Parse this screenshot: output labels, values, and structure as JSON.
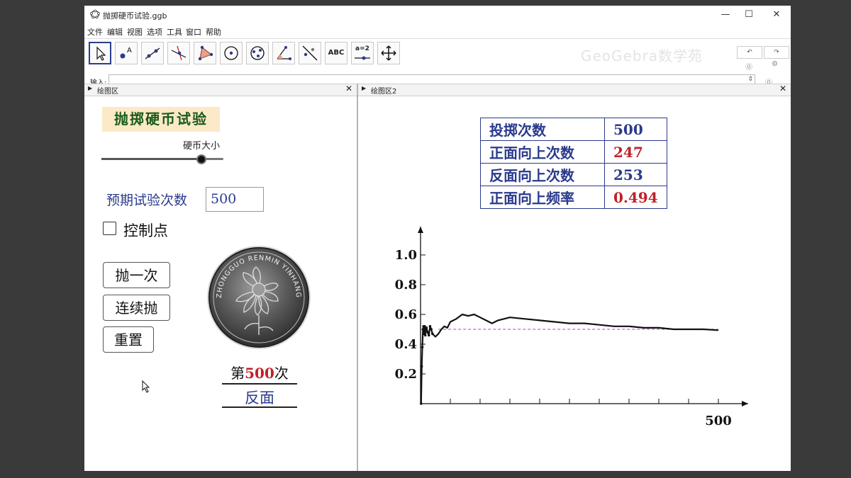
{
  "window": {
    "title": "抛掷硬币试验.ggb",
    "minimize": "—",
    "maximize": "☐",
    "close": "✕"
  },
  "menu": [
    "文件",
    "编辑",
    "视图",
    "选项",
    "工具",
    "窗口",
    "帮助"
  ],
  "toolbar": {
    "tools": [
      "move",
      "point",
      "line",
      "perpendicular",
      "polygon",
      "circle",
      "conic",
      "angle",
      "reflect",
      "text",
      "slider",
      "move-view"
    ],
    "text_tool_label": "ABC",
    "slider_tool_label": "a=2",
    "watermark": "GeoGebra数学苑"
  },
  "input_bar": {
    "label": "输入:"
  },
  "panels": {
    "left_title": "绘图区",
    "right_title": "绘图区2"
  },
  "left": {
    "title": "抛掷硬币试验",
    "slider_label": "硬币大小",
    "slider_value": 0.82,
    "trial_label": "预期试验次数",
    "trial_value": "500",
    "checkbox_label": "控制点",
    "buttons": {
      "toss_once": "抛一次",
      "toss_continuous": "连续抛",
      "reset": "重置"
    },
    "coin_text": "ZHONGGUO RENMIN YINHANG",
    "count_prefix": "第",
    "count_number": "500",
    "count_suffix": "次",
    "result": "反面"
  },
  "stats": {
    "rows": [
      {
        "label": "投掷次数",
        "value": "500",
        "color": "#2a3a8c"
      },
      {
        "label": "正面向上次数",
        "value": "247",
        "color": "#c0212a"
      },
      {
        "label": "反面向上次数",
        "value": "253",
        "color": "#2a3a8c"
      },
      {
        "label": "正面向上频率",
        "value": "0.494",
        "color": "#c0212a"
      }
    ]
  },
  "chart_data": {
    "type": "line",
    "title": "",
    "xlabel": "",
    "ylabel": "",
    "xlim": [
      0,
      500
    ],
    "ylim": [
      0,
      1.0
    ],
    "x_tick_labels": [
      "500"
    ],
    "y_ticks": [
      0.2,
      0.4,
      0.6,
      0.8,
      1.0
    ],
    "reference_line": 0.5,
    "series": [
      {
        "values_x": [
          1,
          2,
          3,
          4,
          5,
          6,
          7,
          8,
          9,
          10,
          12,
          14,
          16,
          18,
          20,
          25,
          30,
          35,
          40,
          45,
          50,
          60,
          70,
          80,
          90,
          100,
          110,
          120,
          130,
          140,
          150,
          175,
          200,
          225,
          250,
          275,
          300,
          325,
          350,
          375,
          400,
          425,
          450,
          475,
          500
        ],
        "values_y": [
          0.0,
          0.25,
          0.38,
          0.5,
          0.52,
          0.47,
          0.52,
          0.46,
          0.5,
          0.51,
          0.48,
          0.46,
          0.52,
          0.5,
          0.47,
          0.45,
          0.47,
          0.5,
          0.52,
          0.51,
          0.55,
          0.57,
          0.6,
          0.59,
          0.6,
          0.58,
          0.56,
          0.54,
          0.56,
          0.57,
          0.58,
          0.57,
          0.56,
          0.55,
          0.54,
          0.54,
          0.53,
          0.52,
          0.52,
          0.51,
          0.51,
          0.5,
          0.5,
          0.5,
          0.494
        ]
      }
    ]
  }
}
